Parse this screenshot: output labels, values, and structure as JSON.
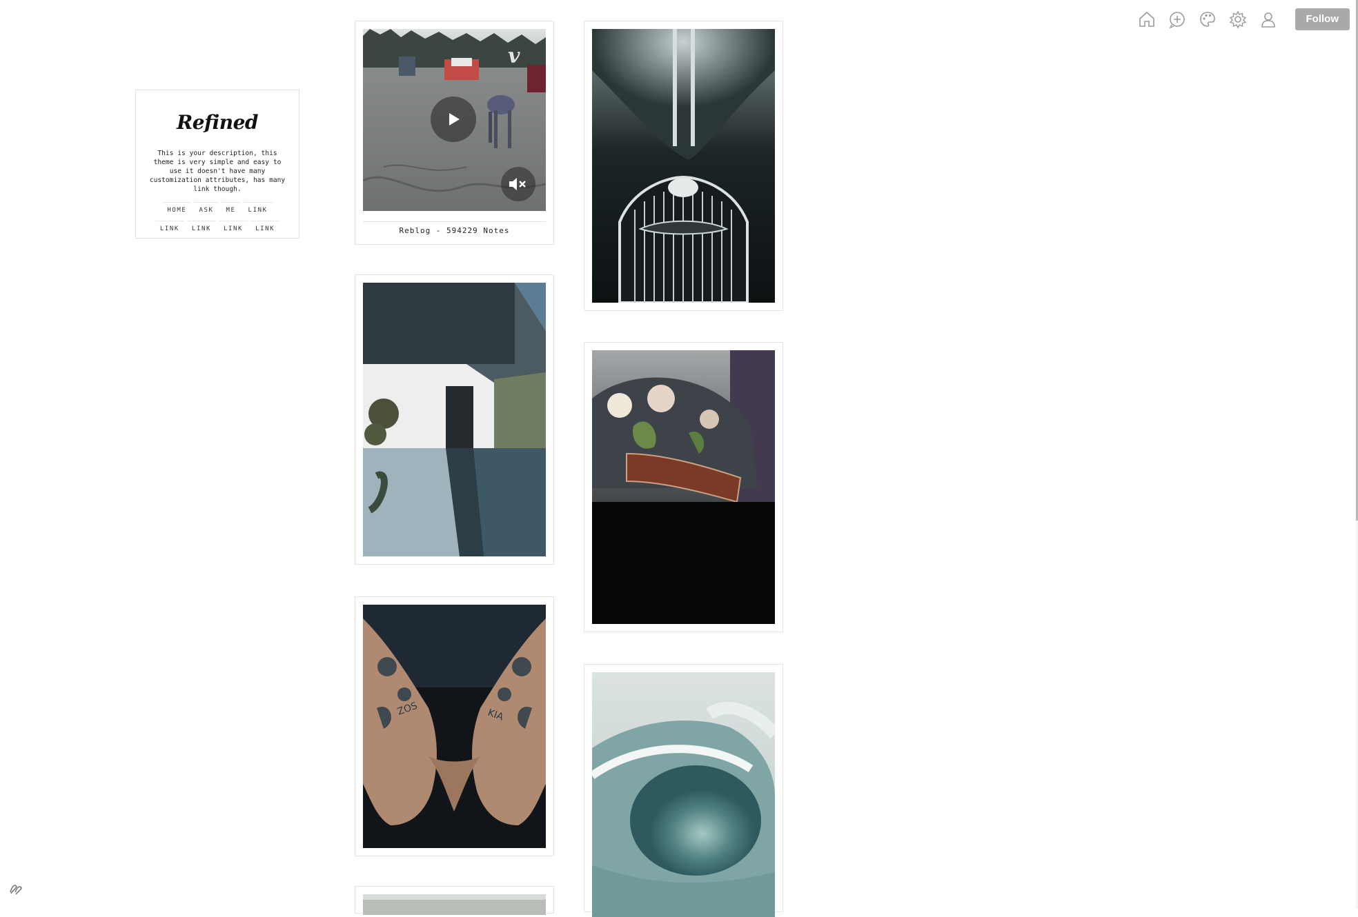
{
  "toolbar": {
    "icons": [
      "home-icon",
      "compose-icon",
      "palette-icon",
      "settings-icon",
      "account-icon"
    ],
    "follow_label": "Follow"
  },
  "sidebar": {
    "title": "Refined",
    "description": "This is your description, this theme is very simple and easy to use it doesn't have many customization attributes, has many link though.",
    "links": [
      "HOME",
      "ASK",
      "ME",
      "LINK",
      "LINK",
      "LINK",
      "LINK",
      "LINK"
    ]
  },
  "posts": [
    {
      "type": "video",
      "footer": "Reblog - 594229 Notes",
      "image": "robot-dog-parking-lot"
    },
    {
      "type": "photo",
      "image": "vintage-car-grille"
    },
    {
      "type": "photo",
      "image": "modern-house-pool"
    },
    {
      "type": "photo",
      "image": "floral-cap"
    },
    {
      "type": "photo",
      "image": "tattooed-hands"
    },
    {
      "type": "photo",
      "image": "ocean-wave"
    },
    {
      "type": "photo",
      "image": "partial-photo"
    }
  ],
  "colors": {
    "follow_bg": "#a9a9a9",
    "border": "#e3e3e3",
    "icon": "#9a9a9a"
  }
}
